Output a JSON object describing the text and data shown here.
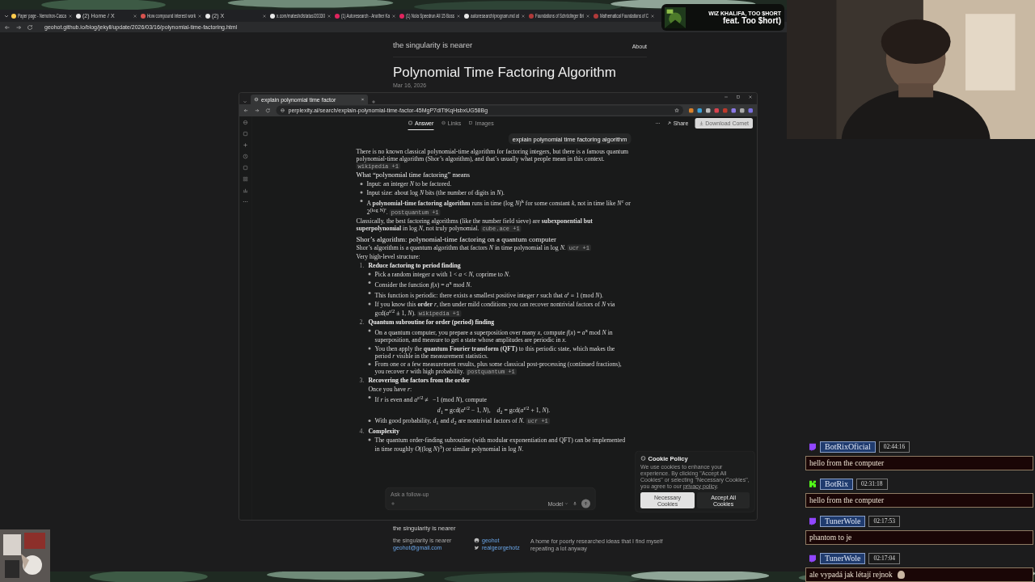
{
  "browser": {
    "tabs": [
      {
        "title": "Paper page - Nemotron-Casca",
        "color": "#ffcc4d"
      },
      {
        "title": "(2) Home / X",
        "color": "#e8e8e8"
      },
      {
        "title": "How compound interest work",
        "color": "#d9534f"
      },
      {
        "title": "(2) X",
        "color": "#e8e8e8"
      },
      {
        "title": "x.com/mateshd/status/20330",
        "color": "#e8e8e8"
      },
      {
        "title": "(1) Autoresearch - Another Ka",
        "color": "#e0245e"
      },
      {
        "title": "(1) Nola Speedrun All 15 Boss",
        "color": "#e0245e"
      },
      {
        "title": "autoresearch/program.md at",
        "color": "#e8e8e8"
      },
      {
        "title": "Foundations of Schrödinger Bri",
        "color": "#b03a3a"
      },
      {
        "title": "Mathematical Foundations of C",
        "color": "#b03a3a"
      }
    ],
    "url": "geohot.github.io/blog/jekyll/update/2026/03/16/polynomial-time-factoring.html"
  },
  "blog": {
    "site_title": "the singularity is nearer",
    "nav": [
      "About"
    ],
    "post_title": "Polynomial Time Factoring Algorithm",
    "date": "Mar 16, 2026",
    "screenshot": {
      "tab_title": "explain polynomial time factor",
      "url": "perplexity.ai/search/explain-polynomial-time-factor-45MgP7diTtKqHsbxUG58Bg",
      "nav_tabs": [
        {
          "label": "Answer",
          "selected": true
        },
        {
          "label": "Links",
          "selected": false
        },
        {
          "label": "Images",
          "selected": false
        }
      ],
      "share": "Share",
      "download": "Download Comet",
      "query": "explain polynomial time factoring algorithm",
      "answer": [
        {
          "kind": "paragraph",
          "text": "There is no known classical polynomial-time algorithm for factoring integers, but there is a famous quantum polynomial-time algorithm (Shor’s algorithm), and that’s usually what people mean in this context.",
          "chip": "wikipedia +1"
        },
        {
          "kind": "heading",
          "text": "What “polynomial time factoring” means"
        },
        {
          "kind": "bullets",
          "children": [
            {
              "text": "Input: an integer *N* to be factored."
            },
            {
              "text": "Input size: about log *N* bits (the number of digits in *N*)."
            },
            {
              "text": "A **polynomial-time factoring algorithm** runs in time (log *N*)$^{k}$ for some constant *k*, not in time like *N*$^{c}$ or 2$^{(log N)ᶜ}$.",
              "chip": "postquantum +1"
            }
          ]
        },
        {
          "kind": "paragraph",
          "text": "Classically, the best factoring algorithms (like the number field sieve) are **subexponential but superpolynomial** in log *N*, not truly polynomial.",
          "chip": "cube.ace +1"
        },
        {
          "kind": "section",
          "text": "Shor’s algorithm: polynomial-time factoring on a quantum computer"
        },
        {
          "kind": "paragraph",
          "text": "Shor’s algorithm is a quantum algorithm that factors *N* in time polynomial in log *N*.",
          "chip": "ucr +1"
        },
        {
          "kind": "paragraph",
          "text": "Very high-level structure:"
        },
        {
          "kind": "numbered",
          "children": [
            {
              "number": "1.",
              "title": "Reduce factoring to period finding",
              "children": [
                {
                  "text": "Pick a random integer *a* with 1 < *a* < *N*, coprime to *N*."
                },
                {
                  "text": "Consider the function *f*(*x*) = *a*$^{x}$ mod *N*."
                },
                {
                  "text": "This function is periodic: there exists a smallest positive integer *r* such that *a*$^{r}$ ≡ 1 (mod *N*)."
                },
                {
                  "text": "If you know this **order** *r*, then under mild conditions you can recover nontrivial factors of *N* via gcd(*a*$^{r/2}$ ± 1, *N*).",
                  "chip": "wikipedia +1"
                }
              ]
            },
            {
              "number": "2.",
              "title": "Quantum subroutine for order (period) finding",
              "children": [
                {
                  "text": "On a quantum computer, you prepare a superposition over many *x*, compute *f*(*x*) = *a*$^{x}$ mod *N* in superposition, and measure to get a state whose amplitudes are periodic in *x*."
                },
                {
                  "text": "You then apply the **quantum Fourier transform (QFT)** to this periodic state, which makes the period *r* visible in the measurement statistics."
                },
                {
                  "text": "From one or a few measurement results, plus some classical post-processing (continued fractions), you recover *r* with high probability.",
                  "chip": "postquantum +1"
                }
              ]
            },
            {
              "number": "3.",
              "title": "Recovering the factors from the order",
              "intro": "Once you have *r*:",
              "children": [
                {
                  "text": "If *r* is even and *a*$^{r/2}$ ≢ −1 (mod *N*), compute",
                  "equation": "*d*$_{1}$ = gcd(*a*$^{r/2}$ − 1, *N*),    *d*$_{2}$ = gcd(*a*$^{r/2}$ + 1, *N*)."
                },
                {
                  "text": "With good probability, *d*$_{1}$ and *d*$_{2}$ are nontrivial factors of *N*.",
                  "chip": "ucr +1"
                }
              ]
            },
            {
              "number": "4.",
              "title": "Complexity",
              "children": [
                {
                  "text": "The quantum order-finding subroutine (with modular exponentiation and QFT) can be implemented in time roughly *O*((log *N*)$^{3}$) or similar polynomial in log *N*."
                }
              ]
            }
          ]
        }
      ],
      "followup": {
        "placeholder": "Ask a follow-up",
        "model": "Model"
      },
      "cookie": {
        "title": "Cookie Policy",
        "text": "We use cookies to enhance your experience. By clicking \"Accept All Cookies\" or selecting \"Necessary Cookies\", you agree to our",
        "link": "privacy policy",
        "text_after": ".",
        "buttons": [
          {
            "label": "Necessary Cookies",
            "kind": "secondary"
          },
          {
            "label": "Accept All Cookies",
            "kind": "primary"
          }
        ]
      }
    },
    "footer": {
      "heading": "the singularity is nearer",
      "name": "the singularity is nearer",
      "email": "geohot@gmail.com",
      "links": [
        {
          "kind": "github",
          "label": "geohot"
        },
        {
          "kind": "twitter",
          "label": "realgeorgehotz"
        }
      ],
      "description": "A home for poorly researched ideas that I find myself repeating a lot anyway"
    }
  },
  "now_playing": {
    "artist": "WIZ KHALIFA, TOO $HORT",
    "title": "feat. Too $hort)"
  },
  "chat": [
    {
      "kind": "twitch",
      "color": "#9146ff",
      "user": "BotRixOficial",
      "time": "02:44:16",
      "message": "hello from the computer"
    },
    {
      "kind": "kick",
      "color": "#53fc18",
      "user": "BotRix",
      "time": "02:31:18",
      "message": "hello from the computer"
    },
    {
      "kind": "twitch",
      "color": "#9146ff",
      "user": "TunerWole",
      "time": "02:17:53",
      "message": "phantom to je"
    },
    {
      "kind": "twitch",
      "color": "#9146ff",
      "user": "TunerWole",
      "time": "02:17:04",
      "message": "ale vypadá jak létají rejnok"
    }
  ]
}
